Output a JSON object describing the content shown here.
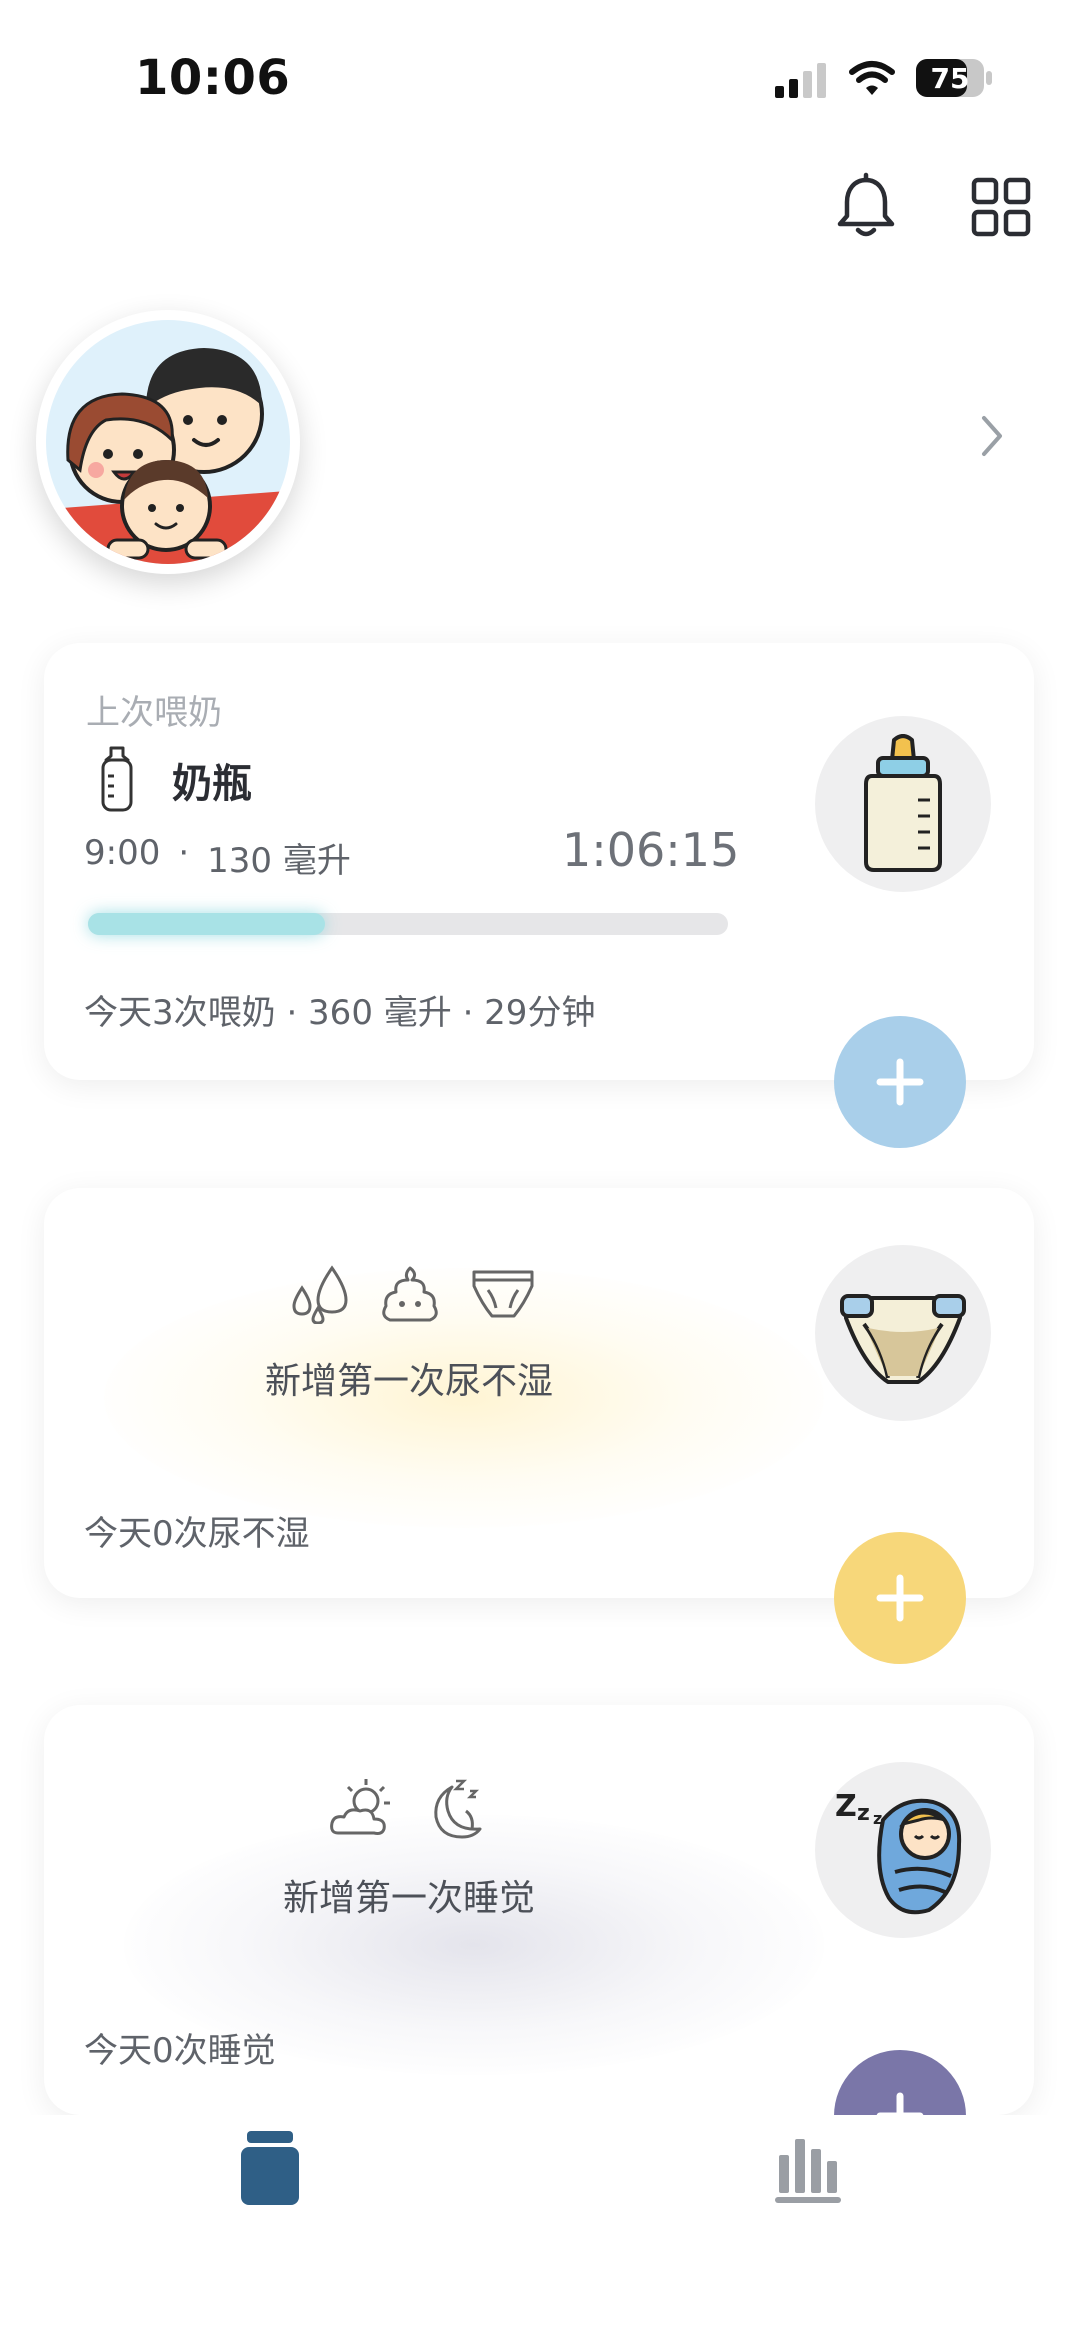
{
  "status_bar": {
    "time": "10:06",
    "battery": "75"
  },
  "colors": {
    "accent": "#2f5f86",
    "feed_fab": "#a9cfea",
    "diaper_fab": "#f7d77a",
    "sleep_fab": "#7a76a8",
    "progress": "#a8e2e6"
  },
  "header": {
    "icons": [
      "bell-icon",
      "grid-icon"
    ]
  },
  "profile": {
    "avatar": "family-avatar",
    "chevron": "chevron-right-icon"
  },
  "feeding_card": {
    "label": "上次喂奶",
    "type": "奶瓶",
    "time": "9:00",
    "amount": "130 毫升",
    "dot": "·",
    "elapsed": "1:06:15",
    "progress": 0.37,
    "summary": "今天3次喂奶 · 360 毫升 · 29分钟"
  },
  "diaper_card": {
    "prompt": "新增第一次尿不湿",
    "summary": "今天0次尿不湿",
    "icons": [
      "water-drops-icon",
      "poop-icon",
      "diaper-outline-icon"
    ]
  },
  "sleep_card": {
    "prompt": "新增第一次睡觉",
    "summary": "今天0次睡觉",
    "icons": [
      "sun-cloud-icon",
      "moon-sleep-icon"
    ]
  },
  "bottom_tabs": [
    {
      "name": "records",
      "icon": "jar-icon",
      "active": true
    },
    {
      "name": "stats",
      "icon": "bar-chart-icon",
      "active": false
    }
  ]
}
